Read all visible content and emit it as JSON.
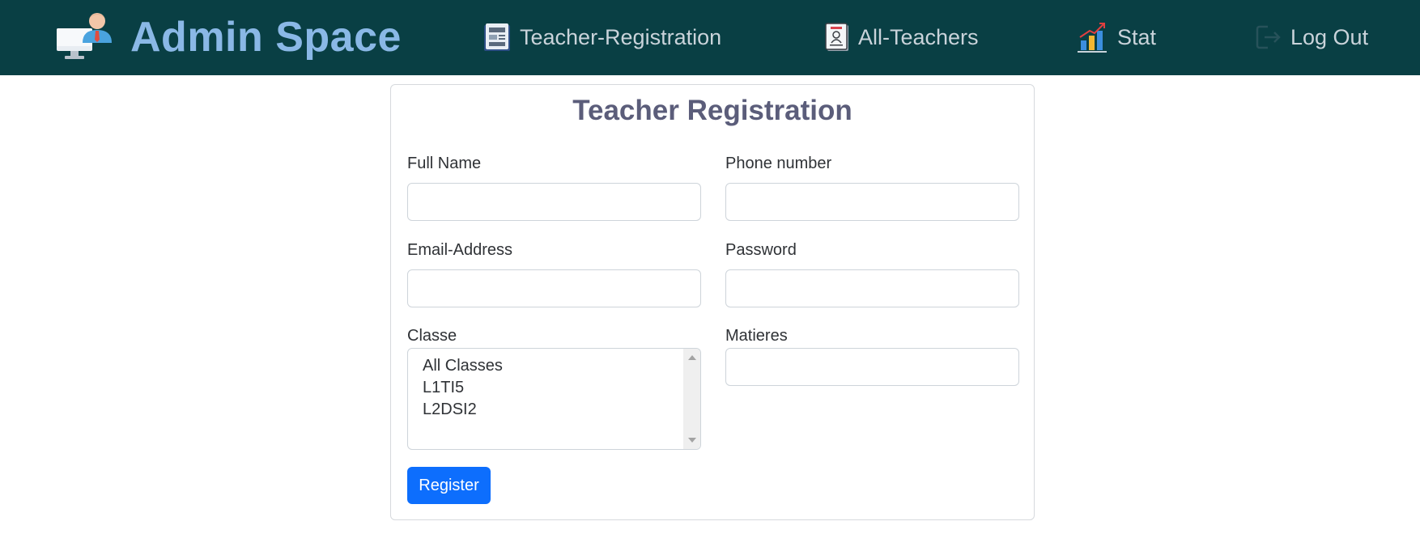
{
  "navbar": {
    "brand": "Admin Space",
    "background": "#093f44",
    "brand_color": "#8ab8e6",
    "items": [
      {
        "label": "Teacher-Registration",
        "icon": "registration-form-icon"
      },
      {
        "label": "All-Teachers",
        "icon": "teacher-card-icon"
      },
      {
        "label": "Stat",
        "icon": "bar-chart-icon"
      },
      {
        "label": "Log Out",
        "icon": "logout-icon"
      }
    ]
  },
  "form": {
    "title": "Teacher Registration",
    "title_color": "#5b5d7a",
    "full_name": {
      "label": "Full Name",
      "value": ""
    },
    "phone": {
      "label": "Phone number",
      "value": ""
    },
    "email": {
      "label": "Email-Address",
      "value": ""
    },
    "password": {
      "label": "Password",
      "value": ""
    },
    "classe": {
      "label": "Classe",
      "options": [
        "All Classes",
        "L1TI5",
        "L2DSI2"
      ]
    },
    "matieres": {
      "label": "Matieres",
      "value": ""
    },
    "register_label": "Register",
    "register_color": "#0d6efd"
  }
}
